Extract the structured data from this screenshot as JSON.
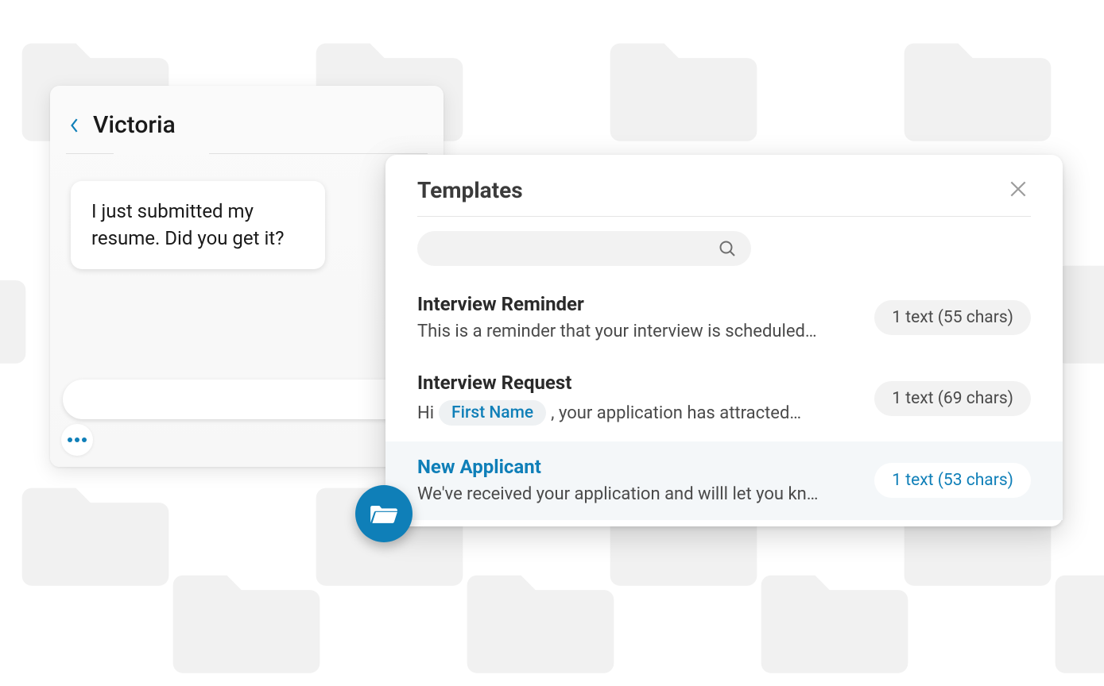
{
  "chat": {
    "contact_name": "Victoria",
    "message": "I just submitted my resume. Did you get it?",
    "input_placeholder": ""
  },
  "templates": {
    "title": "Templates",
    "search_placeholder": "",
    "items": [
      {
        "title": "Interview Reminder",
        "preview_before": "This is a reminder that your interview is scheduled…",
        "merge_tag": "",
        "preview_after": "",
        "badge": "1 text (55 chars)",
        "active": false
      },
      {
        "title": "Interview Request",
        "preview_before": "Hi ",
        "merge_tag": "First Name",
        "preview_after": " , your application has attracted…",
        "badge": "1 text (69 chars)",
        "active": false
      },
      {
        "title": "New Applicant",
        "preview_before": "We've received your application and willl let you kn…",
        "merge_tag": "",
        "preview_after": "",
        "badge": "1 text (53 chars)",
        "active": true
      }
    ]
  }
}
